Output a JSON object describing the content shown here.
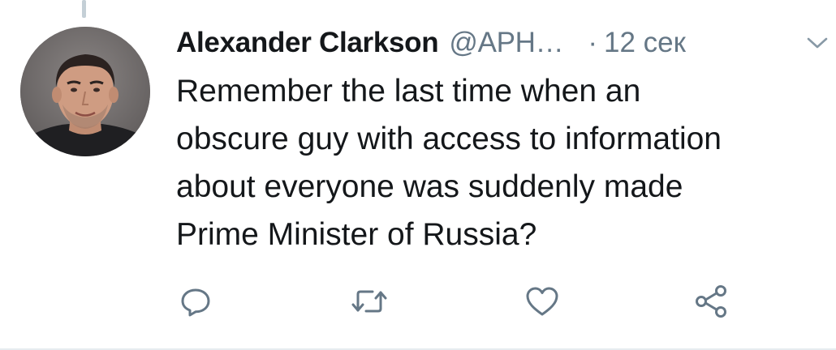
{
  "tweet": {
    "author": {
      "display_name": "Alexander Clarkson",
      "handle": "@APH…",
      "avatar_icon": "profile-photo"
    },
    "separator": "·",
    "timestamp": "12 сек",
    "menu_icon": "chevron-down-icon",
    "text_lines": [
      "Remember the last time when an",
      "obscure guy with access to information",
      "about everyone was suddenly made",
      "Prime Minister of Russia?"
    ]
  },
  "actions": [
    {
      "name": "reply",
      "icon": "comment-bubble-icon"
    },
    {
      "name": "retweet",
      "icon": "retweet-arrows-icon"
    },
    {
      "name": "like",
      "icon": "heart-icon"
    },
    {
      "name": "share",
      "icon": "share-nodes-icon"
    }
  ],
  "colors": {
    "primary_text": "#14171a",
    "secondary_text": "#657786",
    "icon": "#657786",
    "divider": "#e6ecf0",
    "thread_line": "#c4cfd6"
  }
}
